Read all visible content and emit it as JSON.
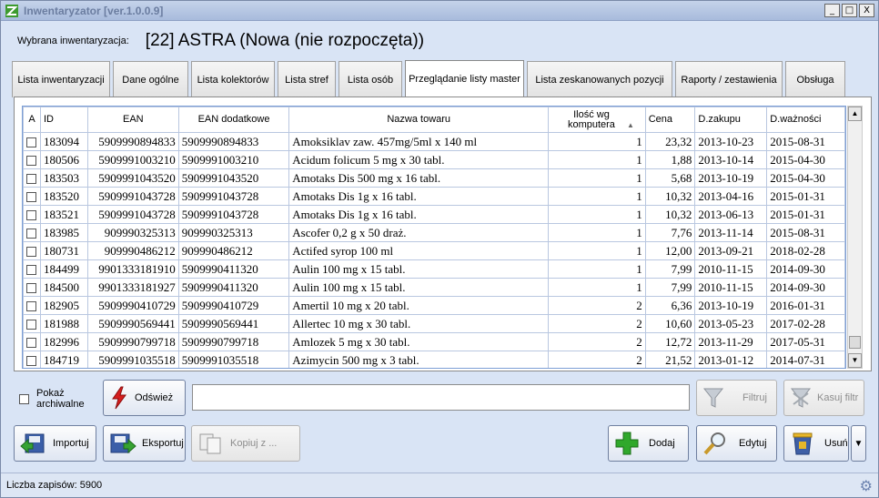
{
  "window": {
    "title": "Inwentaryzator [ver.1.0.0.9]",
    "minimize": "_",
    "maximize": "□",
    "close": "X"
  },
  "header": {
    "label": "Wybrana inwentaryzacja:",
    "value": "[22] ASTRA (Nowa (nie rozpoczęta))"
  },
  "tabs": [
    {
      "label": "Lista inwentaryzacji"
    },
    {
      "label": "Dane ogólne"
    },
    {
      "label": "Lista kolektorów"
    },
    {
      "label": "Lista stref"
    },
    {
      "label": "Lista osób"
    },
    {
      "label": "Przeglądanie listy master"
    },
    {
      "label": "Lista zeskanowanych pozycji"
    },
    {
      "label": "Raporty / zestawienia"
    },
    {
      "label": "Obsługa"
    }
  ],
  "table": {
    "columns": {
      "a": "A",
      "id": "ID",
      "ean": "EAN",
      "ean2": "EAN dodatkowe",
      "name": "Nazwa towaru",
      "qty": "Ilość wg komputera",
      "price": "Cena",
      "dpurchase": "D.zakupu",
      "dexpiry": "D.ważności"
    },
    "rows": [
      {
        "id": "183094",
        "ean": "5909990894833",
        "ean2": "5909990894833",
        "name": "Amoksiklav zaw. 457mg/5ml x 140 ml",
        "qty": "1",
        "price": "23,32",
        "dpurchase": "2013-10-23",
        "dexpiry": "2015-08-31"
      },
      {
        "id": "180506",
        "ean": "5909991003210",
        "ean2": "5909991003210",
        "name": "Acidum folicum 5 mg x 30 tabl.",
        "qty": "1",
        "price": "1,88",
        "dpurchase": "2013-10-14",
        "dexpiry": "2015-04-30"
      },
      {
        "id": "183503",
        "ean": "5909991043520",
        "ean2": "5909991043520",
        "name": "Amotaks Dis 500 mg x 16 tabl.",
        "qty": "1",
        "price": "5,68",
        "dpurchase": "2013-10-19",
        "dexpiry": "2015-04-30"
      },
      {
        "id": "183520",
        "ean": "5909991043728",
        "ean2": "5909991043728",
        "name": "Amotaks Dis  1g x 16 tabl.",
        "qty": "1",
        "price": "10,32",
        "dpurchase": "2013-04-16",
        "dexpiry": "2015-01-31"
      },
      {
        "id": "183521",
        "ean": "5909991043728",
        "ean2": "5909991043728",
        "name": "Amotaks Dis  1g x 16 tabl.",
        "qty": "1",
        "price": "10,32",
        "dpurchase": "2013-06-13",
        "dexpiry": "2015-01-31"
      },
      {
        "id": "183985",
        "ean": "909990325313",
        "ean2": "909990325313",
        "name": "Ascofer 0,2 g x 50 draż.",
        "qty": "1",
        "price": "7,76",
        "dpurchase": "2013-11-14",
        "dexpiry": "2015-08-31"
      },
      {
        "id": "180731",
        "ean": "909990486212",
        "ean2": "909990486212",
        "name": "Actifed syrop  100 ml",
        "qty": "1",
        "price": "12,00",
        "dpurchase": "2013-09-21",
        "dexpiry": "2018-02-28"
      },
      {
        "id": "184499",
        "ean": "9901333181910",
        "ean2": "5909990411320",
        "name": "Aulin 100 mg x 15 tabl.",
        "qty": "1",
        "price": "7,99",
        "dpurchase": "2010-11-15",
        "dexpiry": "2014-09-30"
      },
      {
        "id": "184500",
        "ean": "9901333181927",
        "ean2": "5909990411320",
        "name": "Aulin 100 mg x 15 tabl.",
        "qty": "1",
        "price": "7,99",
        "dpurchase": "2010-11-15",
        "dexpiry": "2014-09-30"
      },
      {
        "id": "182905",
        "ean": "5909990410729",
        "ean2": "5909990410729",
        "name": "Amertil 10 mg x  20 tabl.",
        "qty": "2",
        "price": "6,36",
        "dpurchase": "2013-10-19",
        "dexpiry": "2016-01-31"
      },
      {
        "id": "181988",
        "ean": "5909990569441",
        "ean2": "5909990569441",
        "name": "Allertec 10 mg x  30 tabl.",
        "qty": "2",
        "price": "10,60",
        "dpurchase": "2013-05-23",
        "dexpiry": "2017-02-28"
      },
      {
        "id": "182996",
        "ean": "5909990799718",
        "ean2": "5909990799718",
        "name": "Amlozek  5 mg x 30 tabl.",
        "qty": "2",
        "price": "12,72",
        "dpurchase": "2013-11-29",
        "dexpiry": "2017-05-31"
      },
      {
        "id": "184719",
        "ean": "5909991035518",
        "ean2": "5909991035518",
        "name": "Azimycin 500 mg x 3 tabl.",
        "qty": "2",
        "price": "21,52",
        "dpurchase": "2013-01-12",
        "dexpiry": "2014-07-31"
      }
    ]
  },
  "controls": {
    "archive_label": "Pokaż archiwalne",
    "refresh": "Odśwież",
    "filter": "Filtruj",
    "clear_filter": "Kasuj filtr",
    "import": "Importuj",
    "export": "Eksportuj",
    "copy": "Kopiuj z ...",
    "add": "Dodaj",
    "edit": "Edytuj",
    "delete": "Usuń"
  },
  "status": {
    "text": "Liczba zapisów: 5900"
  },
  "colors": {
    "title_text": "#6b7da0",
    "window_bg": "#d9e4f5",
    "grid_border": "#b9c7e0"
  }
}
